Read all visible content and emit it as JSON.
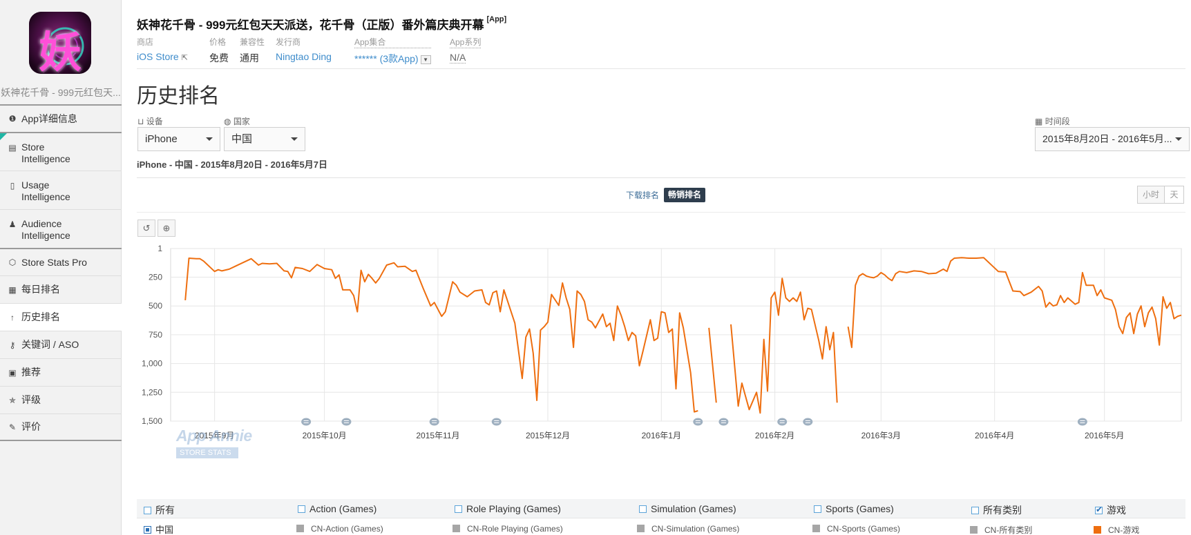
{
  "app": {
    "title": "妖神花千骨 - 999元红包天天派送，花千骨（正版）番外篇庆典开幕",
    "tag": "[App]",
    "short_name": "妖神花千骨 - 999元红包天...",
    "icon_glyph": "妖"
  },
  "meta": {
    "store_label": "商店",
    "store_value": "iOS Store",
    "price_label": "价格",
    "price_value": "免费",
    "compat_label": "兼容性",
    "compat_value": "通用",
    "publisher_label": "发行商",
    "publisher_value": "Ningtao Ding",
    "collection_label": "App集合",
    "collection_value": "****** (3款App)",
    "series_label": "App系列",
    "series_value": "N/A"
  },
  "sidebar": {
    "items": [
      {
        "icon": "info-icon",
        "glyph": "❶",
        "label": "App详细信息"
      },
      {
        "icon": "store-icon",
        "glyph": "▤",
        "label": "Store Intelligence"
      },
      {
        "icon": "usage-icon",
        "glyph": "▯",
        "label": "Usage Intelligence"
      },
      {
        "icon": "person-icon",
        "glyph": "♟",
        "label": "Audience Intelligence"
      },
      {
        "icon": "gem-icon",
        "glyph": "⬡",
        "label": "Store Stats Pro"
      },
      {
        "icon": "calendar-icon",
        "glyph": "▦",
        "label": "每日排名"
      },
      {
        "icon": "arrow-up-icon",
        "glyph": "↑",
        "label": "历史排名"
      },
      {
        "icon": "key-icon",
        "glyph": "⚷",
        "label": "关键词 / ASO"
      },
      {
        "icon": "featured-icon",
        "glyph": "▣",
        "label": "推荐"
      },
      {
        "icon": "star-icon",
        "glyph": "✯",
        "label": "评级"
      },
      {
        "icon": "comment-icon",
        "glyph": "✎",
        "label": "评价"
      }
    ]
  },
  "page": {
    "title": "历史排名",
    "device_label": "设备",
    "device_value": "iPhone",
    "country_label": "国家",
    "country_value": "中国",
    "period_label": "时间段",
    "period_value": "2015年8月20日 - 2016年5月...",
    "subtitle": "iPhone - 中国 - 2015年8月20日 - 2016年5月7日"
  },
  "tabs": {
    "downloads": "下载排名",
    "grossing": "畅销排名"
  },
  "granularity": {
    "hour": "小时",
    "day": "天"
  },
  "watermark": {
    "title": "App Annie",
    "subtitle": "STORE STATS"
  },
  "colors": {
    "line": "#ee6e0f",
    "accent": "#3e8ccb",
    "nav_dark": "#2e3d4d"
  },
  "chart_data": {
    "type": "line",
    "y_reversed": true,
    "ylim": [
      1,
      1500
    ],
    "yticks": [
      1,
      250,
      500,
      750,
      1000,
      1250,
      1500
    ],
    "ytick_labels": [
      "1",
      "250",
      "500",
      "750",
      "1,000",
      "1,250",
      "1,500"
    ],
    "x_range": [
      "2015-08-20",
      "2016-05-07"
    ],
    "xticks": [
      {
        "date": "2015-09-01",
        "label": "2015年9月"
      },
      {
        "date": "2015-10-01",
        "label": "2015年10月"
      },
      {
        "date": "2015-11-01",
        "label": "2015年11月"
      },
      {
        "date": "2015-12-01",
        "label": "2015年12月"
      },
      {
        "date": "2016-01-01",
        "label": "2016年1月"
      },
      {
        "date": "2016-02-01",
        "label": "2016年2月"
      },
      {
        "date": "2016-03-01",
        "label": "2016年3月"
      },
      {
        "date": "2016-04-01",
        "label": "2016年4月"
      },
      {
        "date": "2016-05-01",
        "label": "2016年5月"
      }
    ],
    "annotation_dates": [
      "2015-09-26",
      "2015-10-07",
      "2015-10-31",
      "2015-11-17",
      "2016-01-11",
      "2016-01-18",
      "2016-02-03",
      "2016-02-10",
      "2016-04-25"
    ],
    "series": [
      {
        "name": "CN-游戏",
        "points": [
          [
            "2015-08-24",
            450
          ],
          [
            "2015-08-25",
            85
          ],
          [
            "2015-08-27",
            90
          ],
          [
            "2015-08-28",
            90
          ],
          [
            "2015-08-29",
            110
          ],
          [
            "2015-08-31",
            170
          ],
          [
            "2015-09-01",
            200
          ],
          [
            "2015-09-02",
            185
          ],
          [
            "2015-09-03",
            195
          ],
          [
            "2015-09-05",
            180
          ],
          [
            "2015-09-07",
            150
          ],
          [
            "2015-09-09",
            120
          ],
          [
            "2015-09-11",
            90
          ],
          [
            "2015-09-13",
            145
          ],
          [
            "2015-09-14",
            130
          ],
          [
            "2015-09-16",
            135
          ],
          [
            "2015-09-18",
            130
          ],
          [
            "2015-09-20",
            195
          ],
          [
            "2015-09-21",
            200
          ],
          [
            "2015-09-22",
            255
          ],
          [
            "2015-09-23",
            165
          ],
          [
            "2015-09-25",
            175
          ],
          [
            "2015-09-27",
            200
          ],
          [
            "2015-09-29",
            140
          ],
          [
            "2015-10-01",
            175
          ],
          [
            "2015-10-03",
            185
          ],
          [
            "2015-10-04",
            260
          ],
          [
            "2015-10-05",
            230
          ],
          [
            "2015-10-06",
            360
          ],
          [
            "2015-10-08",
            360
          ],
          [
            "2015-10-09",
            410
          ],
          [
            "2015-10-10",
            550
          ],
          [
            "2015-10-11",
            190
          ],
          [
            "2015-10-12",
            290
          ],
          [
            "2015-10-13",
            225
          ],
          [
            "2015-10-14",
            260
          ],
          [
            "2015-10-15",
            300
          ],
          [
            "2015-10-16",
            260
          ],
          [
            "2015-10-18",
            145
          ],
          [
            "2015-10-20",
            125
          ],
          [
            "2015-10-21",
            160
          ],
          [
            "2015-10-23",
            155
          ],
          [
            "2015-10-25",
            200
          ],
          [
            "2015-10-26",
            190
          ],
          [
            "2015-10-28",
            350
          ],
          [
            "2015-10-30",
            500
          ],
          [
            "2015-10-31",
            470
          ],
          [
            "2015-11-02",
            590
          ],
          [
            "2015-11-03",
            550
          ],
          [
            "2015-11-05",
            290
          ],
          [
            "2015-11-06",
            320
          ],
          [
            "2015-11-07",
            380
          ],
          [
            "2015-11-09",
            420
          ],
          [
            "2015-11-11",
            370
          ],
          [
            "2015-11-13",
            360
          ],
          [
            "2015-11-14",
            470
          ],
          [
            "2015-11-15",
            490
          ],
          [
            "2015-11-16",
            385
          ],
          [
            "2015-11-17",
            370
          ],
          [
            "2015-11-18",
            550
          ],
          [
            "2015-11-19",
            360
          ],
          [
            "2015-11-22",
            650
          ],
          [
            "2015-11-24",
            1130
          ],
          [
            "2015-11-25",
            770
          ],
          [
            "2015-11-26",
            700
          ],
          [
            "2015-11-27",
            910
          ],
          [
            "2015-11-28",
            1320
          ],
          [
            "2015-11-29",
            710
          ],
          [
            "2015-11-30",
            680
          ],
          [
            "2015-12-01",
            640
          ],
          [
            "2015-12-02",
            400
          ],
          [
            "2015-12-04",
            495
          ],
          [
            "2015-12-05",
            300
          ],
          [
            "2015-12-06",
            430
          ],
          [
            "2015-12-07",
            530
          ],
          [
            "2015-12-08",
            860
          ],
          [
            "2015-12-09",
            370
          ],
          [
            "2015-12-10",
            400
          ],
          [
            "2015-12-11",
            460
          ],
          [
            "2015-12-12",
            620
          ],
          [
            "2015-12-13",
            640
          ],
          [
            "2015-12-14",
            690
          ],
          [
            "2015-12-16",
            570
          ],
          [
            "2015-12-17",
            680
          ],
          [
            "2015-12-18",
            650
          ],
          [
            "2015-12-19",
            800
          ],
          [
            "2015-12-20",
            500
          ],
          [
            "2015-12-21",
            580
          ],
          [
            "2015-12-22",
            680
          ],
          [
            "2015-12-23",
            800
          ],
          [
            "2015-12-24",
            730
          ],
          [
            "2015-12-25",
            760
          ],
          [
            "2015-12-26",
            1020
          ],
          [
            "2015-12-27",
            890
          ],
          [
            "2015-12-29",
            620
          ],
          [
            "2015-12-30",
            800
          ],
          [
            "2015-12-31",
            780
          ],
          [
            "2016-01-01",
            550
          ],
          [
            "2016-01-02",
            560
          ],
          [
            "2016-01-03",
            730
          ],
          [
            "2016-01-04",
            700
          ],
          [
            "2016-01-05",
            1220
          ],
          [
            "2016-01-06",
            560
          ],
          [
            "2016-01-07",
            690
          ],
          [
            "2016-01-09",
            1080
          ],
          [
            "2016-01-10",
            1420
          ],
          [
            "2016-01-11",
            1410
          ],
          [
            null,
            null
          ],
          [
            "2016-01-14",
            690
          ],
          [
            "2016-01-16",
            1340
          ],
          [
            null,
            null
          ],
          [
            "2016-01-20",
            660
          ],
          [
            "2016-01-22",
            1370
          ],
          [
            "2016-01-23",
            1170
          ],
          [
            "2016-01-25",
            1400
          ],
          [
            "2016-01-27",
            1250
          ],
          [
            "2016-01-28",
            1430
          ],
          [
            "2016-01-29",
            790
          ],
          [
            "2016-01-30",
            1240
          ],
          [
            "2016-01-31",
            430
          ],
          [
            "2016-02-01",
            380
          ],
          [
            "2016-02-02",
            580
          ],
          [
            "2016-02-03",
            260
          ],
          [
            "2016-02-04",
            430
          ],
          [
            "2016-02-05",
            460
          ],
          [
            "2016-02-06",
            430
          ],
          [
            "2016-02-07",
            460
          ],
          [
            "2016-02-08",
            380
          ],
          [
            "2016-02-09",
            620
          ],
          [
            "2016-02-10",
            520
          ],
          [
            "2016-02-11",
            530
          ],
          [
            "2016-02-13",
            800
          ],
          [
            "2016-02-14",
            960
          ],
          [
            "2016-02-15",
            680
          ],
          [
            "2016-02-16",
            880
          ],
          [
            "2016-02-17",
            730
          ],
          [
            "2016-02-18",
            1340
          ],
          [
            null,
            null
          ],
          [
            "2016-02-21",
            680
          ],
          [
            "2016-02-22",
            860
          ],
          [
            "2016-02-23",
            320
          ],
          [
            "2016-02-24",
            240
          ],
          [
            "2016-02-25",
            220
          ],
          [
            "2016-02-26",
            240
          ],
          [
            "2016-02-27",
            250
          ],
          [
            "2016-02-28",
            255
          ],
          [
            "2016-02-29",
            240
          ],
          [
            "2016-03-01",
            210
          ],
          [
            "2016-03-02",
            230
          ],
          [
            "2016-03-03",
            260
          ],
          [
            "2016-03-04",
            280
          ],
          [
            "2016-03-05",
            220
          ],
          [
            "2016-03-06",
            200
          ],
          [
            "2016-03-08",
            210
          ],
          [
            "2016-03-10",
            195
          ],
          [
            "2016-03-12",
            200
          ],
          [
            "2016-03-14",
            220
          ],
          [
            "2016-03-16",
            215
          ],
          [
            "2016-03-18",
            180
          ],
          [
            "2016-03-19",
            200
          ],
          [
            "2016-03-20",
            110
          ],
          [
            "2016-03-21",
            85
          ],
          [
            "2016-03-23",
            80
          ],
          [
            "2016-03-25",
            85
          ],
          [
            "2016-03-27",
            85
          ],
          [
            "2016-03-29",
            80
          ],
          [
            "2016-03-31",
            140
          ],
          [
            "2016-04-02",
            200
          ],
          [
            "2016-04-04",
            205
          ],
          [
            "2016-04-06",
            370
          ],
          [
            "2016-04-08",
            375
          ],
          [
            "2016-04-09",
            410
          ],
          [
            "2016-04-11",
            380
          ],
          [
            "2016-04-13",
            330
          ],
          [
            "2016-04-14",
            370
          ],
          [
            "2016-04-15",
            510
          ],
          [
            "2016-04-16",
            470
          ],
          [
            "2016-04-17",
            500
          ],
          [
            "2016-04-18",
            490
          ],
          [
            "2016-04-19",
            410
          ],
          [
            "2016-04-20",
            470
          ],
          [
            "2016-04-21",
            430
          ],
          [
            "2016-04-23",
            485
          ],
          [
            "2016-04-24",
            470
          ],
          [
            "2016-04-25",
            210
          ],
          [
            "2016-04-26",
            320
          ],
          [
            "2016-04-28",
            320
          ],
          [
            "2016-04-29",
            410
          ],
          [
            "2016-04-30",
            360
          ],
          [
            "2016-05-01",
            430
          ],
          [
            "2016-05-03",
            450
          ],
          [
            "2016-05-04",
            530
          ],
          [
            "2016-05-05",
            680
          ],
          [
            "2016-05-06",
            740
          ],
          [
            "2016-05-07",
            600
          ],
          [
            "2016-05-08",
            560
          ],
          [
            "2016-05-09",
            740
          ],
          [
            "2016-05-10",
            570
          ],
          [
            "2016-05-11",
            500
          ],
          [
            "2016-05-12",
            680
          ],
          [
            "2016-05-13",
            560
          ],
          [
            "2016-05-14",
            510
          ],
          [
            "2016-05-15",
            610
          ],
          [
            "2016-05-16",
            840
          ],
          [
            "2016-05-17",
            420
          ],
          [
            "2016-05-18",
            520
          ],
          [
            "2016-05-19",
            470
          ],
          [
            "2016-05-20",
            610
          ],
          [
            "2016-05-21",
            590
          ],
          [
            "2016-05-22",
            580
          ]
        ]
      }
    ]
  },
  "legend": {
    "row1": [
      {
        "label": "所有",
        "checked": false
      },
      {
        "label": "Action (Games)",
        "checked": false
      },
      {
        "label": "Role Playing (Games)",
        "checked": false
      },
      {
        "label": "Simulation (Games)",
        "checked": false
      },
      {
        "label": "Sports (Games)",
        "checked": false
      },
      {
        "label": "所有类别",
        "checked": false
      },
      {
        "label": "游戏",
        "checked": true
      }
    ],
    "country": "中国",
    "row2": [
      {
        "label": "CN-Action (Games)",
        "color": "#a6a6a6"
      },
      {
        "label": "CN-Role Playing (Games)",
        "color": "#a6a6a6"
      },
      {
        "label": "CN-Simulation (Games)",
        "color": "#a6a6a6"
      },
      {
        "label": "CN-Sports (Games)",
        "color": "#a6a6a6"
      },
      {
        "label": "CN-所有类别",
        "color": "#a6a6a6"
      },
      {
        "label": "CN-游戏",
        "color": "#ee6e0f"
      }
    ]
  }
}
